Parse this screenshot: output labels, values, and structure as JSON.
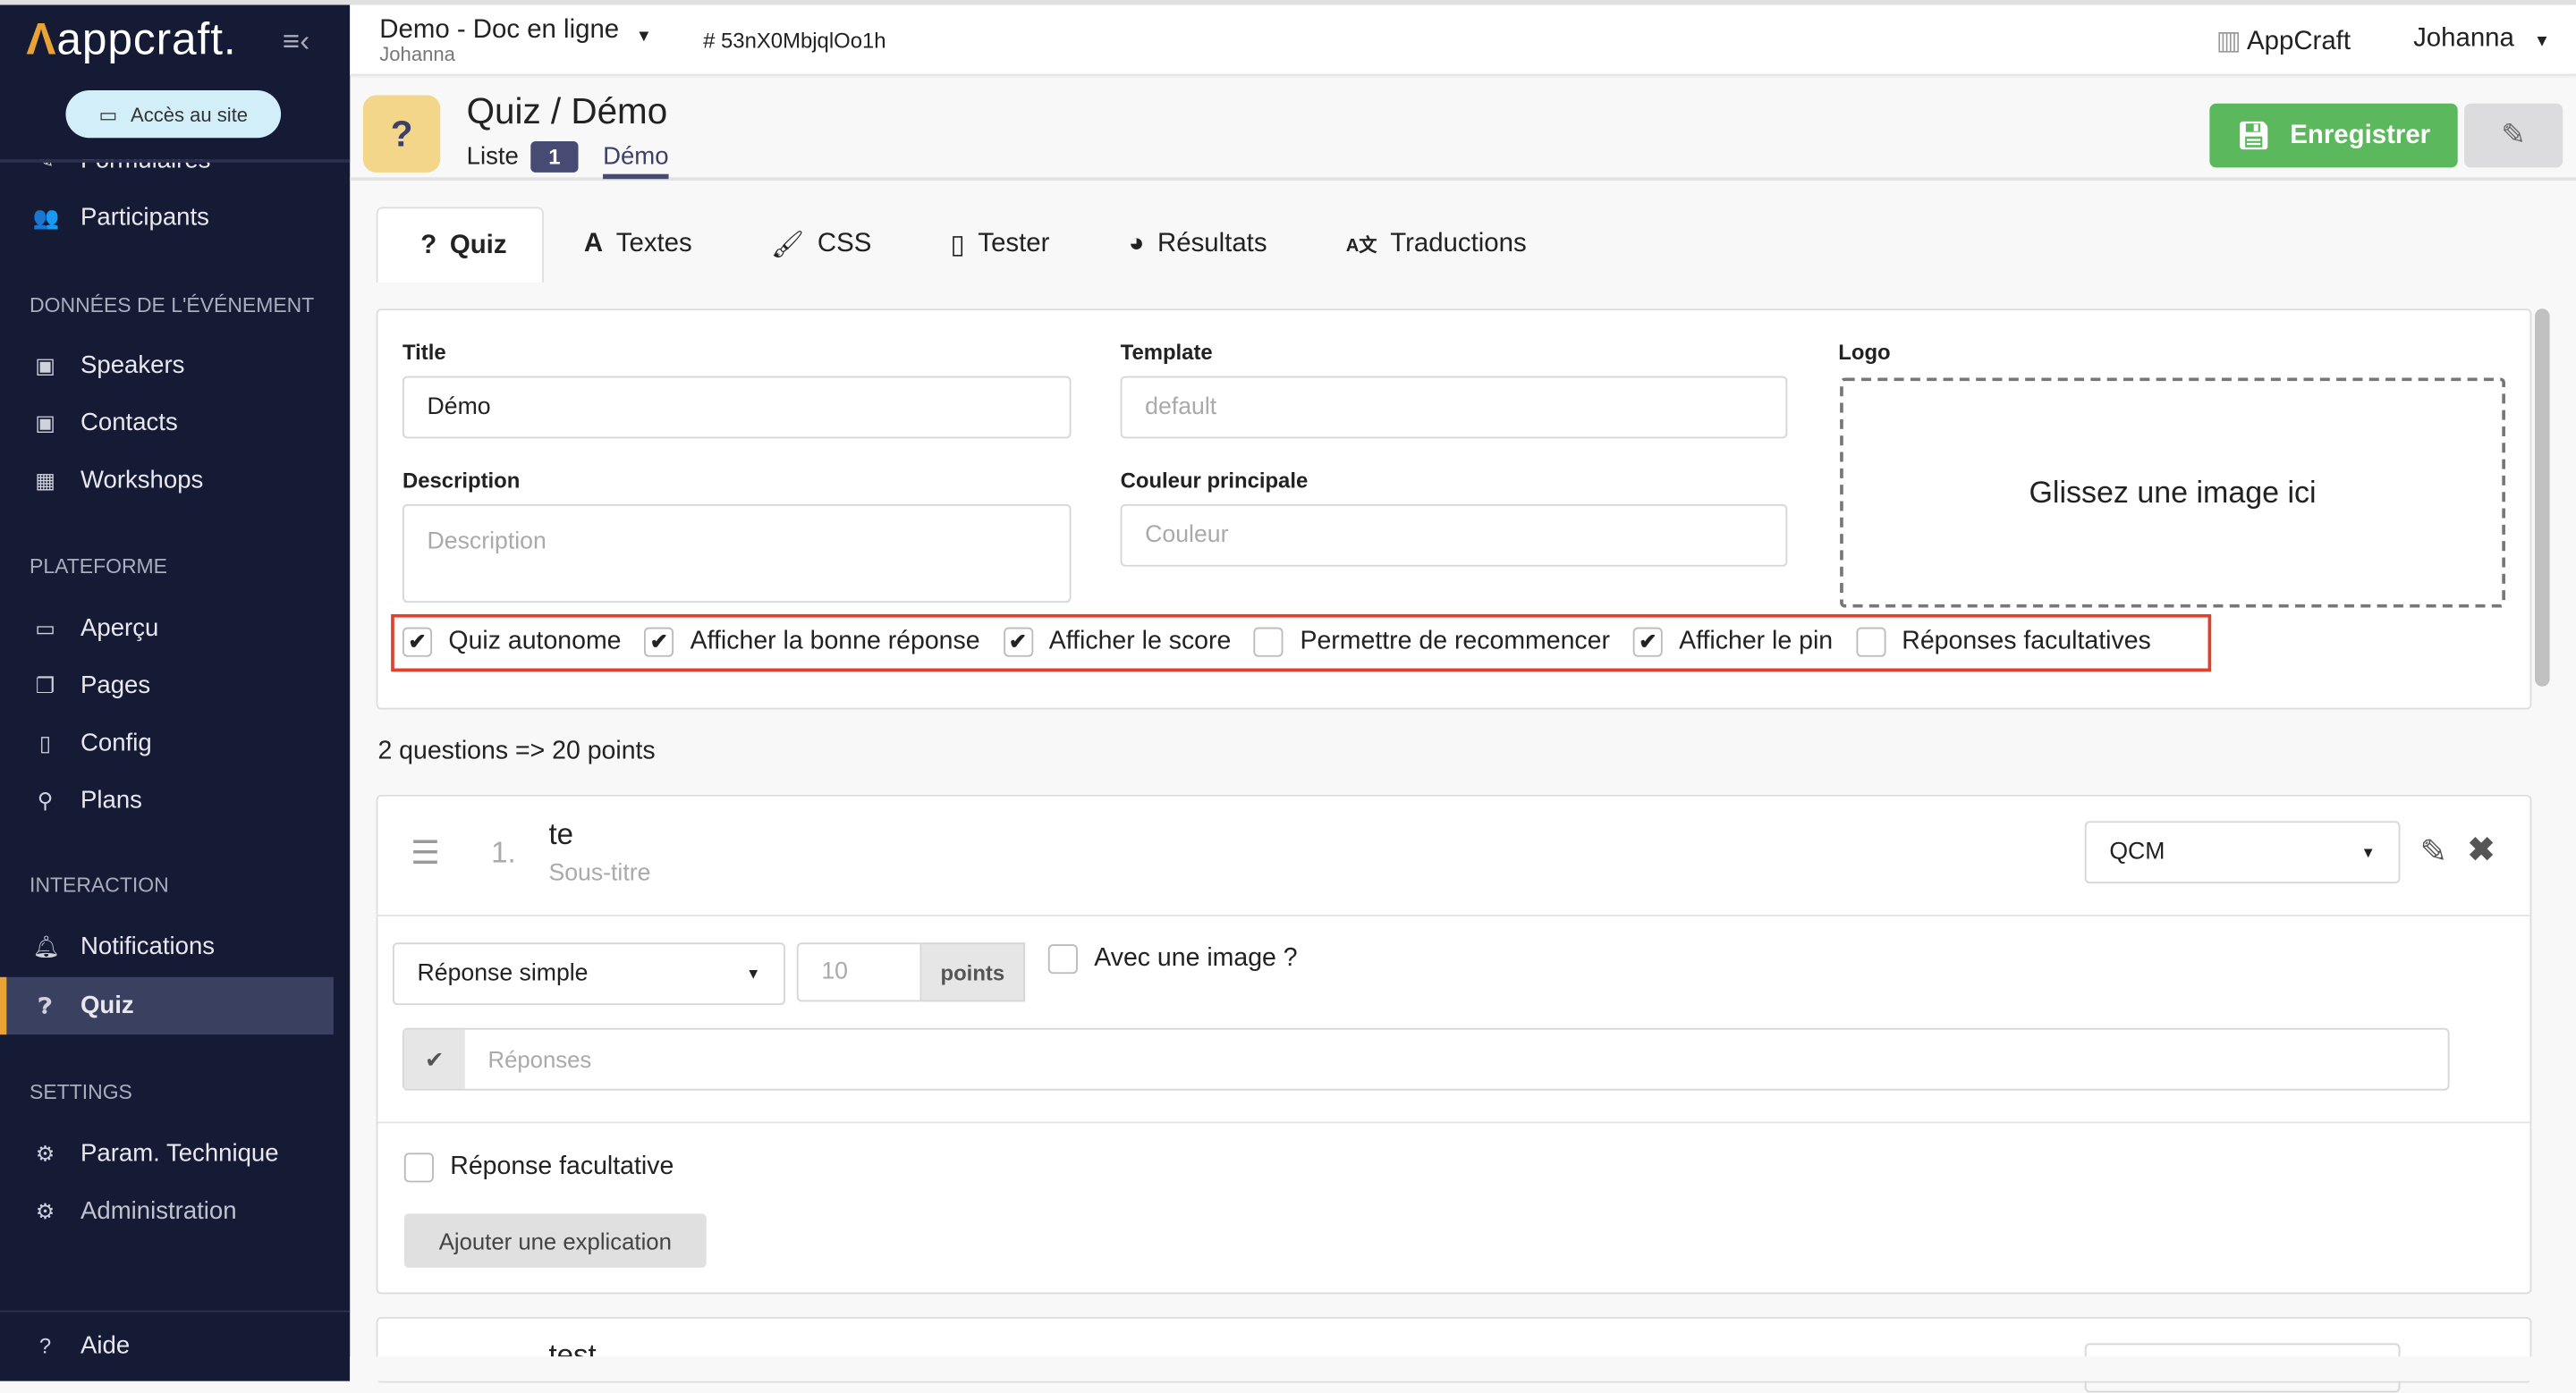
{
  "sidebar": {
    "logo": "appcraft.",
    "site_button": "Accès au site",
    "items_top": [
      {
        "label": "Formulaires",
        "icon": "pen-icon"
      },
      {
        "label": "Participants",
        "icon": "users-icon"
      }
    ],
    "sections": [
      {
        "title": "DONNÉES DE L'ÉVÉNEMENT",
        "items": [
          "Speakers",
          "Contacts",
          "Workshops"
        ]
      },
      {
        "title": "PLATEFORME",
        "items": [
          "Aperçu",
          "Pages",
          "Config",
          "Plans"
        ]
      },
      {
        "title": "INTERACTION",
        "items": [
          "Notifications",
          "Quiz"
        ]
      },
      {
        "title": "SETTINGS",
        "items": [
          "Param. Technique",
          "Administration"
        ]
      }
    ],
    "active": "Quiz",
    "help": "Aide"
  },
  "topbar": {
    "project": "Demo - Doc en ligne",
    "owner": "Johanna",
    "id": "# 53nX0MbjqlOo1h",
    "org": "AppCraft",
    "user": "Johanna"
  },
  "header": {
    "title": "Quiz / Démo",
    "crumb_list": "Liste",
    "crumb_count": "1",
    "crumb_current": "Démo",
    "save": "Enregistrer"
  },
  "tabs": [
    "Quiz",
    "Textes",
    "CSS",
    "Tester",
    "Résultats",
    "Traductions"
  ],
  "form": {
    "title_label": "Title",
    "title_value": "Démo",
    "template_label": "Template",
    "template_placeholder": "default",
    "logo_label": "Logo",
    "logo_drop": "Glissez une image ici",
    "description_label": "Description",
    "description_placeholder": "Description",
    "color_label": "Couleur principale",
    "color_placeholder": "Couleur",
    "options": [
      {
        "label": "Quiz autonome",
        "checked": true
      },
      {
        "label": "Afficher la bonne réponse",
        "checked": true
      },
      {
        "label": "Afficher le score",
        "checked": true
      },
      {
        "label": "Permettre de recommencer",
        "checked": false
      },
      {
        "label": "Afficher le pin",
        "checked": true
      },
      {
        "label": "Réponses facultatives",
        "checked": false
      }
    ]
  },
  "summary": "2 questions => 20 points",
  "question": {
    "number": "1.",
    "title": "te",
    "subtitle": "Sous-titre",
    "type": "QCM",
    "answer_type": "Réponse simple",
    "points_placeholder": "10",
    "points_label": "points",
    "with_image": "Avec une image ?",
    "answers_placeholder": "Réponses",
    "optional": "Réponse facultative",
    "add_explanation": "Ajouter une explication"
  },
  "question2": {
    "title": "test"
  },
  "colors": {
    "sidebar": "#151b35",
    "accent": "#e8a235",
    "save": "#5cb85c",
    "highlight": "#e0412b"
  }
}
